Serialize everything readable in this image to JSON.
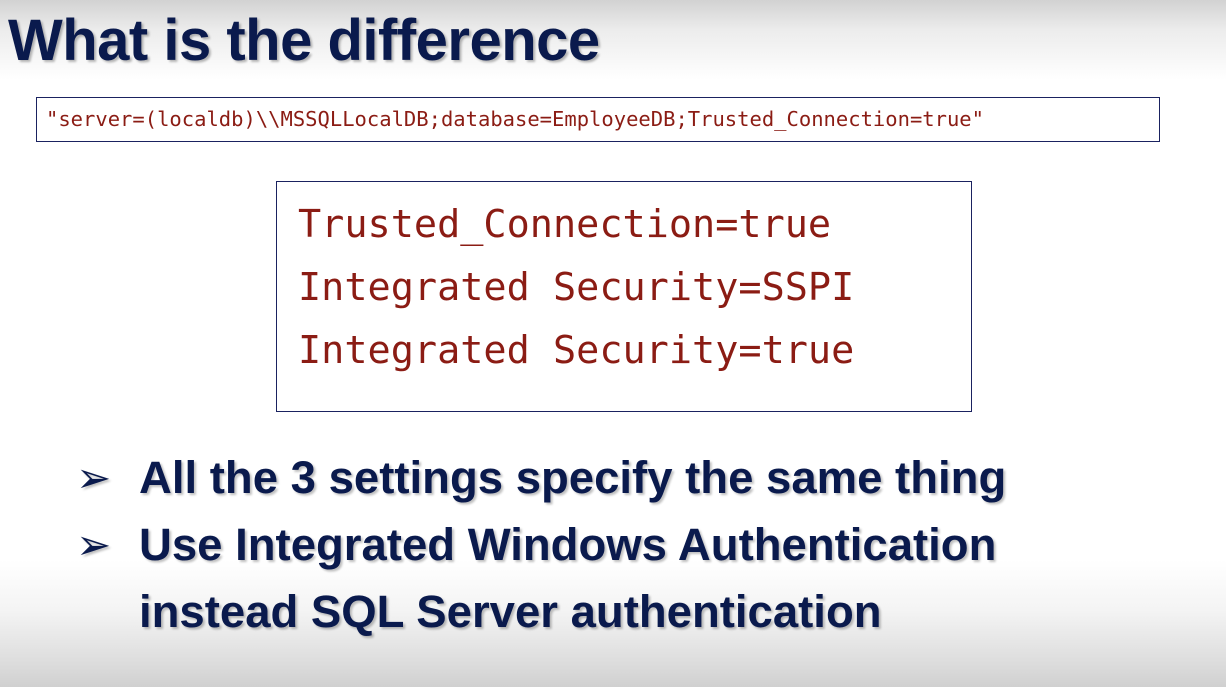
{
  "slide": {
    "title": "What is the difference",
    "connection_string": "\"server=(localdb)\\\\MSSQLLocalDB;database=EmployeeDB;Trusted_Connection=true\"",
    "settings": [
      "Trusted_Connection=true",
      "Integrated Security=SSPI",
      "Integrated Security=true"
    ],
    "bullet_glyph": "➢",
    "bullets": [
      "All the 3 settings specify the same thing",
      "Use Integrated Windows Authentication",
      "instead SQL Server authentication"
    ],
    "colors": {
      "title": "#0a1a4d",
      "code": "#8b1c14",
      "border": "#1a2260"
    }
  }
}
